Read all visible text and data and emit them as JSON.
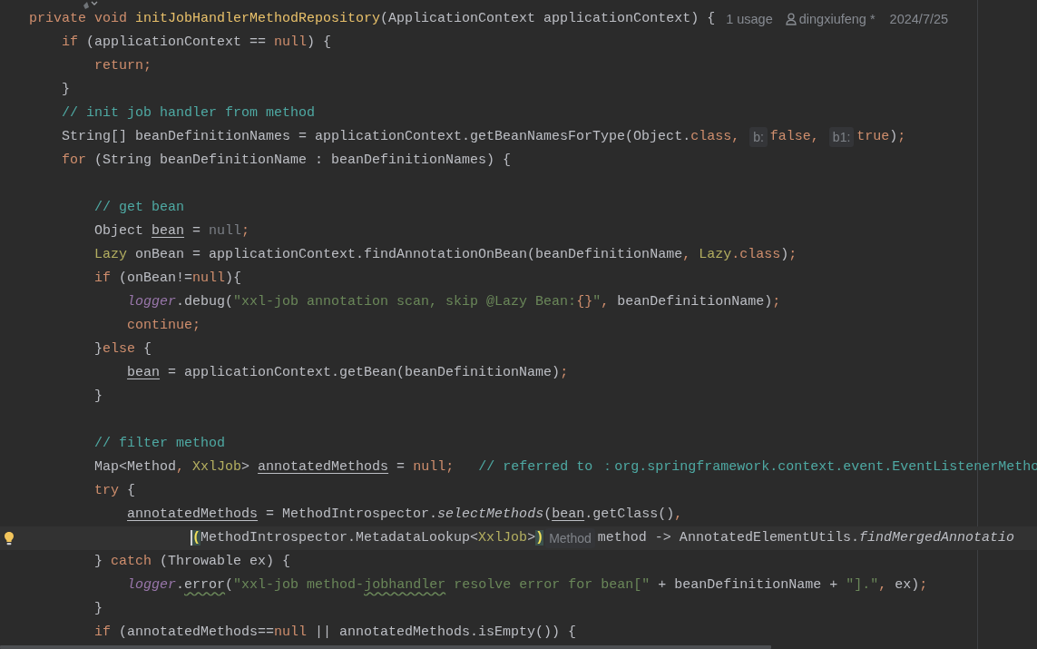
{
  "editor": {
    "lines": [
      {
        "kind": "code",
        "tokens": [
          {
            "kind": "kw",
            "text": "private void "
          },
          {
            "kind": "decl",
            "text": "initJobHandlerMethodRepository"
          },
          {
            "kind": "plain",
            "text": "(ApplicationContext applicationContext) {"
          }
        ],
        "usages": "1 usage",
        "author": "dingxiufeng *",
        "date": "2024/7/25"
      },
      {
        "kind": "code",
        "tokens": [
          {
            "kind": "kw",
            "text": "    if "
          },
          {
            "kind": "plain",
            "text": "(applicationContext == "
          },
          {
            "kind": "kw",
            "text": "null"
          },
          {
            "kind": "plain",
            "text": ") {"
          }
        ]
      },
      {
        "kind": "code",
        "tokens": [
          {
            "kind": "kw",
            "text": "        return;"
          }
        ]
      },
      {
        "kind": "code",
        "tokens": [
          {
            "kind": "plain",
            "text": "    }"
          }
        ]
      },
      {
        "kind": "code",
        "tokens": [
          {
            "kind": "comment",
            "text": "    // init job handler from method"
          }
        ]
      },
      {
        "kind": "code",
        "tokens": [
          {
            "kind": "plain",
            "text": "    String[] beanDefinitionNames = applicationContext.getBeanNamesForType(Object."
          },
          {
            "kind": "kw",
            "text": "class, "
          },
          {
            "kind": "hint",
            "text": "b:"
          },
          {
            "kind": "kw",
            "text": "false, "
          },
          {
            "kind": "hint",
            "text": "b1:"
          },
          {
            "kind": "kw",
            "text": "true"
          },
          {
            "kind": "plain",
            "text": ")"
          },
          {
            "kind": "kw",
            "text": ";"
          }
        ]
      },
      {
        "kind": "code",
        "tokens": [
          {
            "kind": "kw",
            "text": "    for "
          },
          {
            "kind": "plain",
            "text": "(String beanDefinitionName : beanDefinitionNames) {"
          }
        ]
      },
      {
        "kind": "blank"
      },
      {
        "kind": "code",
        "tokens": [
          {
            "kind": "comment",
            "text": "        // get bean"
          }
        ]
      },
      {
        "kind": "code",
        "tokens": [
          {
            "kind": "plain",
            "text": "        Object "
          },
          {
            "kind": "var",
            "text": "bean"
          },
          {
            "kind": "plain",
            "text": " = "
          },
          {
            "kind": "dim",
            "text": "null"
          },
          {
            "kind": "kw",
            "text": ";"
          }
        ]
      },
      {
        "kind": "code",
        "tokens": [
          {
            "kind": "type",
            "text": "        Lazy"
          },
          {
            "kind": "plain",
            "text": " onBean = applicationContext.findAnnotationOnBean(beanDefinitionName"
          },
          {
            "kind": "kw",
            "text": ", "
          },
          {
            "kind": "type",
            "text": "Lazy"
          },
          {
            "kind": "kw",
            "text": ".class"
          },
          {
            "kind": "plain",
            "text": ")"
          },
          {
            "kind": "kw",
            "text": ";"
          }
        ]
      },
      {
        "kind": "code",
        "tokens": [
          {
            "kind": "kw",
            "text": "        if "
          },
          {
            "kind": "plain",
            "text": "(onBean!="
          },
          {
            "kind": "kw",
            "text": "null"
          },
          {
            "kind": "plain",
            "text": "){"
          }
        ]
      },
      {
        "kind": "code",
        "tokens": [
          {
            "kind": "field",
            "text": "            logger"
          },
          {
            "kind": "plain",
            "text": ".debug("
          },
          {
            "kind": "str",
            "text": "\"xxl-job annotation scan, skip @Lazy Bean:"
          },
          {
            "kind": "kw",
            "text": "{}"
          },
          {
            "kind": "str",
            "text": "\""
          },
          {
            "kind": "kw",
            "text": ", "
          },
          {
            "kind": "plain",
            "text": "beanDefinitionName)"
          },
          {
            "kind": "kw",
            "text": ";"
          }
        ]
      },
      {
        "kind": "code",
        "tokens": [
          {
            "kind": "kw",
            "text": "            continue;"
          }
        ]
      },
      {
        "kind": "code",
        "tokens": [
          {
            "kind": "plain",
            "text": "        }"
          },
          {
            "kind": "kw",
            "text": "else "
          },
          {
            "kind": "plain",
            "text": "{"
          }
        ]
      },
      {
        "kind": "code",
        "tokens": [
          {
            "kind": "var",
            "text": "            bean"
          },
          {
            "kind": "plain",
            "text": " = applicationContext.getBean(beanDefinitionName)"
          },
          {
            "kind": "kw",
            "text": ";"
          }
        ]
      },
      {
        "kind": "code",
        "tokens": [
          {
            "kind": "plain",
            "text": "        }"
          }
        ]
      },
      {
        "kind": "blank"
      },
      {
        "kind": "code",
        "tokens": [
          {
            "kind": "comment",
            "text": "        // filter method"
          }
        ]
      },
      {
        "kind": "code",
        "tokens": [
          {
            "kind": "plain",
            "text": "        Map<Method"
          },
          {
            "kind": "kw",
            "text": ", "
          },
          {
            "kind": "type",
            "text": "XxlJob"
          },
          {
            "kind": "plain",
            "text": "> "
          },
          {
            "kind": "var",
            "text": "annotatedMethods"
          },
          {
            "kind": "plain",
            "text": " = "
          },
          {
            "kind": "kw",
            "text": "null;   "
          },
          {
            "kind": "comment",
            "text": "// referred to ：org.springframework.context.event.EventListenerMetho"
          }
        ]
      },
      {
        "kind": "code",
        "tokens": [
          {
            "kind": "kw",
            "text": "        try "
          },
          {
            "kind": "plain",
            "text": "{"
          }
        ]
      },
      {
        "kind": "code",
        "tokens": [
          {
            "kind": "var",
            "text": "            annotatedMethods"
          },
          {
            "kind": "plain",
            "text": " = MethodIntrospector."
          },
          {
            "kind": "static",
            "text": "selectMethods"
          },
          {
            "kind": "plain",
            "text": "("
          },
          {
            "kind": "var",
            "text": "bean"
          },
          {
            "kind": "plain",
            "text": ".getClass()"
          },
          {
            "kind": "kw",
            "text": ","
          }
        ]
      },
      {
        "kind": "code",
        "current": true,
        "tokens": [
          {
            "kind": "match",
            "text": "                    ("
          },
          {
            "kind": "plain",
            "text": "MethodIntrospector.MetadataLookup<"
          },
          {
            "kind": "type",
            "text": "XxlJob"
          },
          {
            "kind": "plain",
            "text": ">"
          },
          {
            "kind": "match",
            "text": ")"
          },
          {
            "kind": "hint",
            "text": "Method"
          },
          {
            "kind": "plain",
            "text": "method -> AnnotatedElementUtils."
          },
          {
            "kind": "static",
            "text": "findMergedAnnotatio"
          }
        ]
      },
      {
        "kind": "code",
        "tokens": [
          {
            "kind": "plain",
            "text": "        } "
          },
          {
            "kind": "kw",
            "text": "catch "
          },
          {
            "kind": "plain",
            "text": "(Throwable ex) {"
          }
        ]
      },
      {
        "kind": "code",
        "tokens": [
          {
            "kind": "field",
            "text": "            logger"
          },
          {
            "kind": "plain",
            "text": "."
          },
          {
            "kind": "typo",
            "text": "error"
          },
          {
            "kind": "plain",
            "text": "("
          },
          {
            "kind": "str",
            "text": "\"xxl-job method-"
          },
          {
            "kind": "strtypo",
            "text": "jobhandler"
          },
          {
            "kind": "str",
            "text": " resolve error for bean[\""
          },
          {
            "kind": "plain",
            "text": " + beanDefinitionName + "
          },
          {
            "kind": "str",
            "text": "\"].\""
          },
          {
            "kind": "kw",
            "text": ", "
          },
          {
            "kind": "plain",
            "text": "ex)"
          },
          {
            "kind": "kw",
            "text": ";"
          }
        ]
      },
      {
        "kind": "code",
        "tokens": [
          {
            "kind": "plain",
            "text": "        }"
          }
        ]
      },
      {
        "kind": "code",
        "tokens": [
          {
            "kind": "kw",
            "text": "        if "
          },
          {
            "kind": "plain",
            "text": "(annotatedMethods=="
          },
          {
            "kind": "kw",
            "text": "null "
          },
          {
            "kind": "plain",
            "text": "|| annotatedMethods.isEmpty()) {"
          }
        ]
      }
    ]
  }
}
